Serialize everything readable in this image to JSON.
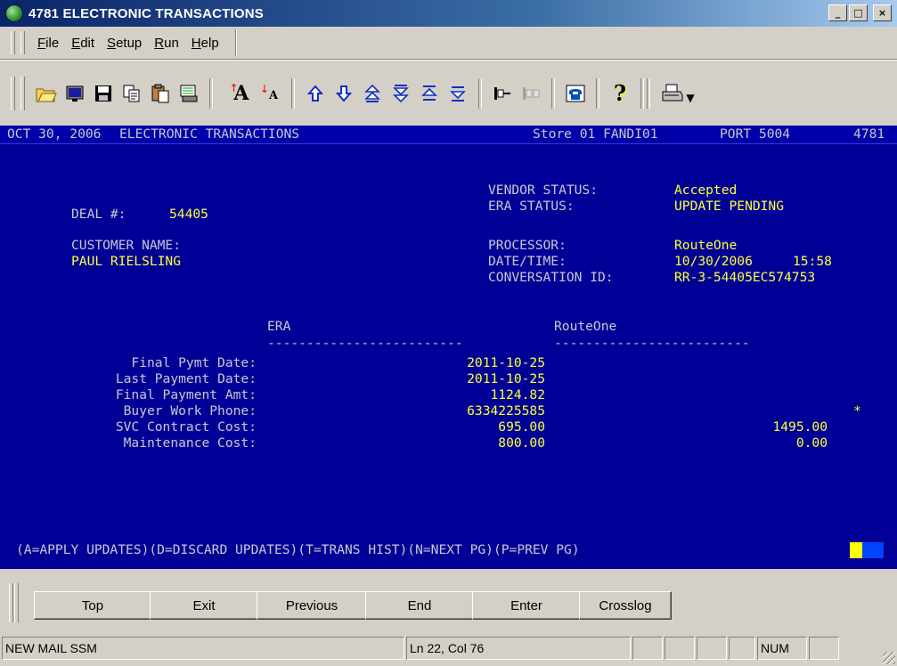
{
  "window": {
    "title": "4781 ELECTRONIC TRANSACTIONS",
    "controls": {
      "minimize": "_",
      "maximize": "□",
      "close": "×"
    }
  },
  "menu": [
    {
      "label": "File",
      "key": "F",
      "rest": "ile"
    },
    {
      "label": "Edit",
      "key": "E",
      "rest": "dit"
    },
    {
      "label": "Setup",
      "key": "S",
      "rest": "etup"
    },
    {
      "label": "Run",
      "key": "R",
      "rest": "un"
    },
    {
      "label": "Help",
      "key": "H",
      "rest": "elp"
    }
  ],
  "toolbar": {
    "icons": [
      "open-folder-icon",
      "screen-icon",
      "save-icon",
      "copy-icon",
      "paste-icon",
      "print-screen-icon",
      "font-increase-icon",
      "font-decrease-icon",
      "up-arrow-icon",
      "down-arrow-icon",
      "page-up-icon",
      "page-down-icon",
      "top-icon",
      "bottom-icon",
      "connect-icon",
      "disconnect-icon",
      "phone-icon",
      "help-icon",
      "printer-icon"
    ]
  },
  "terminal": {
    "header": {
      "date": "OCT 30, 2006",
      "title": "ELECTRONIC TRANSACTIONS",
      "store": "Store 01 FANDI01",
      "port": "PORT 5004",
      "id": "4781"
    },
    "deal_label": "DEAL #:",
    "deal_value": "54405",
    "customer_label": "CUSTOMER NAME:",
    "customer_value": "PAUL RIELSLING",
    "vendor_status_label": "VENDOR STATUS:",
    "vendor_status_value": "Accepted",
    "era_status_label": "ERA STATUS:",
    "era_status_value": "UPDATE PENDING",
    "processor_label": "PROCESSOR:",
    "processor_value": "RouteOne",
    "datetime_label": "DATE/TIME:",
    "datetime_date": "10/30/2006",
    "datetime_time": "15:58",
    "conversation_label": "CONVERSATION ID:",
    "conversation_value": "RR-3-54405EC574753",
    "col_era": "ERA",
    "col_routeone": "RouteOne",
    "divider_era": "-------------------------",
    "divider_routeone": "-------------------------",
    "rows": [
      {
        "label": "Final Pymt Date:",
        "era": "2011-10-25",
        "routeone": "",
        "flag": ""
      },
      {
        "label": "Last Payment Date:",
        "era": "2011-10-25",
        "routeone": "",
        "flag": ""
      },
      {
        "label": "Final Payment Amt:",
        "era": "1124.82",
        "routeone": "",
        "flag": ""
      },
      {
        "label": "Buyer Work Phone:",
        "era": "6334225585",
        "routeone": "",
        "flag": "*"
      },
      {
        "label": "SVC Contract Cost:",
        "era": "695.00",
        "routeone": "1495.00",
        "flag": ""
      },
      {
        "label": "Maintenance Cost:",
        "era": "800.00",
        "routeone": "0.00",
        "flag": ""
      }
    ],
    "prompt": "(A=APPLY UPDATES)(D=DISCARD UPDATES)(T=TRANS HIST)(N=NEXT PG)(P=PREV PG)"
  },
  "function_buttons": [
    "Top",
    "Exit",
    "Previous",
    "End",
    "Enter",
    "Crosslog"
  ],
  "status": {
    "message": "NEW MAIL SSM",
    "position": "Ln 22, Col 76",
    "num": "NUM"
  }
}
